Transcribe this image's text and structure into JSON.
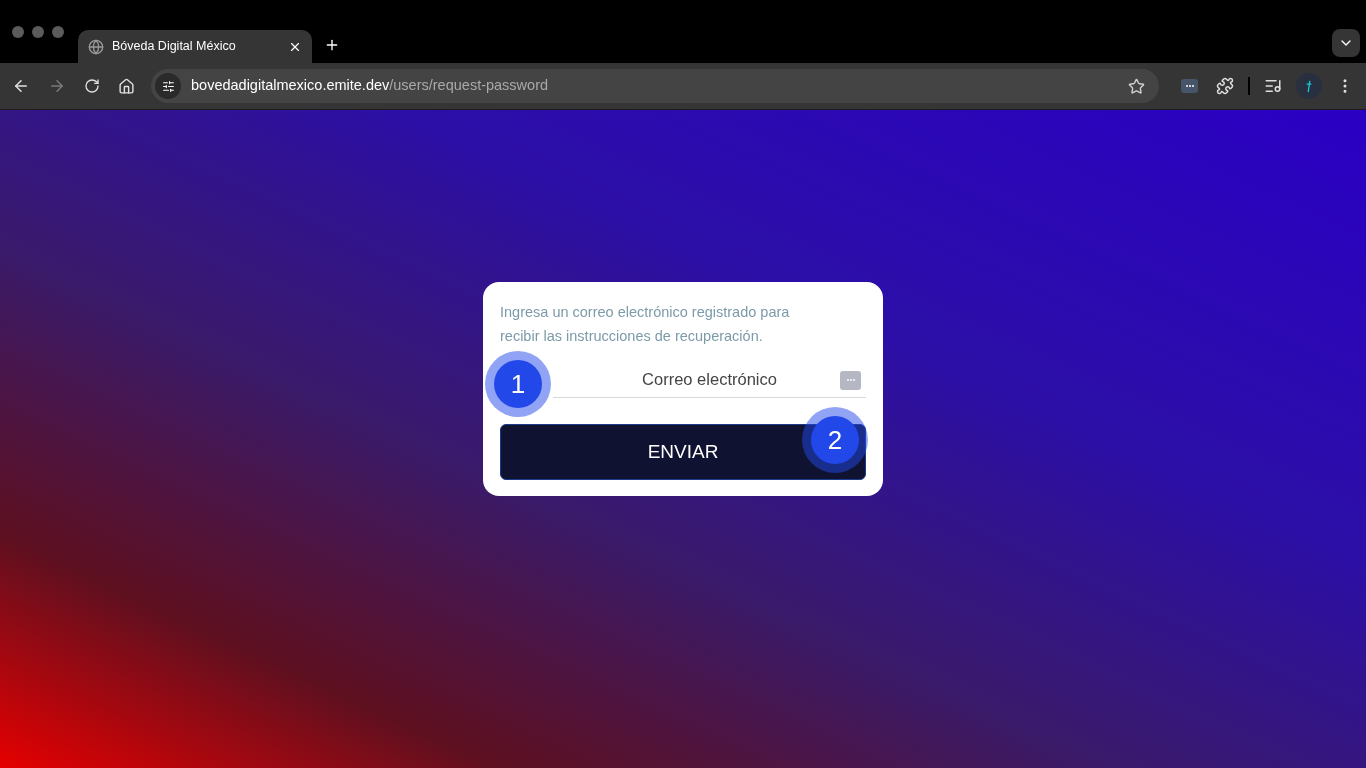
{
  "browser": {
    "tab": {
      "title": "Bóveda Digital México"
    },
    "url": {
      "host": "bovedadigitalmexico.emite.dev",
      "path": "/users/request-password"
    }
  },
  "card": {
    "instructions": "Ingresa un correo electrónico registrado para recibir las instrucciones de recuperación.",
    "email_field": {
      "placeholder": "Correo electrónico"
    },
    "submit_button": "ENVIAR"
  },
  "step_markers": [
    "1",
    "2"
  ]
}
